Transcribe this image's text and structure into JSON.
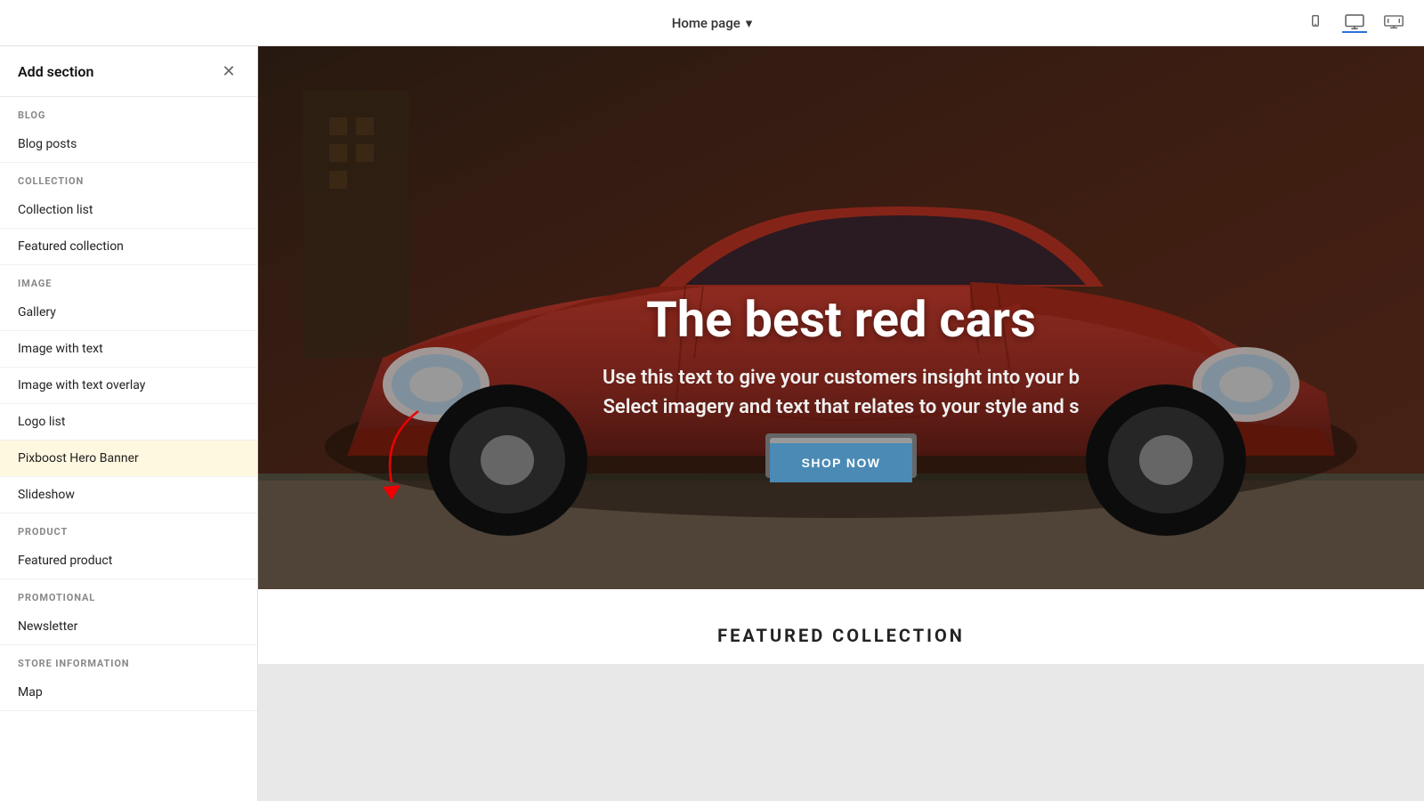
{
  "header": {
    "page_label": "Home page",
    "chevron": "▾",
    "close_label": "✕"
  },
  "sidebar": {
    "title": "Add section",
    "categories": [
      {
        "name": "BLOG",
        "items": [
          "Blog posts"
        ]
      },
      {
        "name": "COLLECTION",
        "items": [
          "Collection list",
          "Featured collection"
        ]
      },
      {
        "name": "IMAGE",
        "items": [
          "Gallery",
          "Image with text",
          "Image with text overlay",
          "Logo list",
          "Pixboost Hero Banner",
          "Slideshow"
        ]
      },
      {
        "name": "PRODUCT",
        "items": [
          "Featured product"
        ]
      },
      {
        "name": "PROMOTIONAL",
        "items": [
          "Newsletter"
        ]
      },
      {
        "name": "STORE INFORMATION",
        "items": [
          "Map"
        ]
      }
    ]
  },
  "preview": {
    "hero": {
      "title": "The best red cars",
      "subtitle1": "Use this text to give your customers insight into your b",
      "subtitle2": "Select imagery and text that relates to your style and s",
      "button_label": "SHOP NOW"
    },
    "featured_collection": {
      "title": "FEATURED COLLECTION"
    }
  },
  "viewport_icons": {
    "mobile": "mobile",
    "desktop": "desktop",
    "wide": "wide"
  },
  "highlighted_item": "Pixboost Hero Banner"
}
